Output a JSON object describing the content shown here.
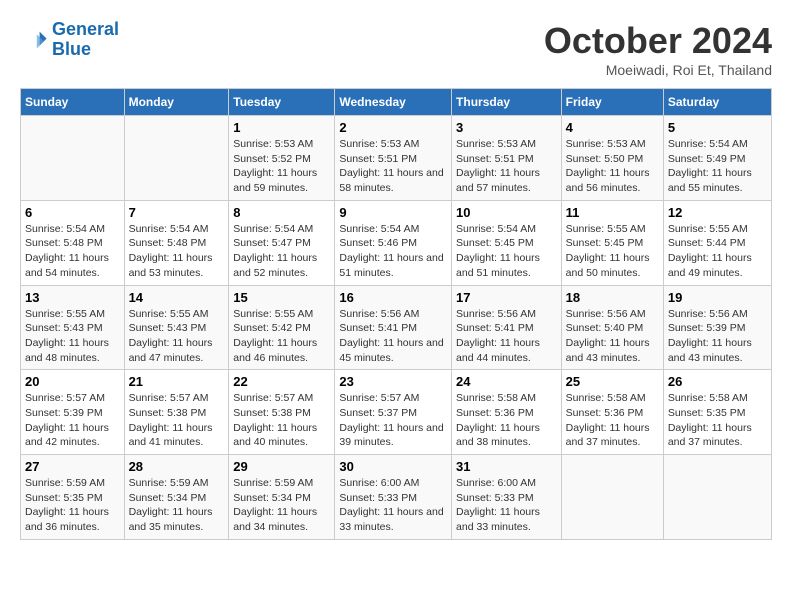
{
  "header": {
    "logo_line1": "General",
    "logo_line2": "Blue",
    "month_year": "October 2024",
    "location": "Moeiwadi, Roi Et, Thailand"
  },
  "weekdays": [
    "Sunday",
    "Monday",
    "Tuesday",
    "Wednesday",
    "Thursday",
    "Friday",
    "Saturday"
  ],
  "weeks": [
    [
      {
        "day": "",
        "content": ""
      },
      {
        "day": "",
        "content": ""
      },
      {
        "day": "1",
        "sunrise": "Sunrise: 5:53 AM",
        "sunset": "Sunset: 5:52 PM",
        "daylight": "Daylight: 11 hours and 59 minutes."
      },
      {
        "day": "2",
        "sunrise": "Sunrise: 5:53 AM",
        "sunset": "Sunset: 5:51 PM",
        "daylight": "Daylight: 11 hours and 58 minutes."
      },
      {
        "day": "3",
        "sunrise": "Sunrise: 5:53 AM",
        "sunset": "Sunset: 5:51 PM",
        "daylight": "Daylight: 11 hours and 57 minutes."
      },
      {
        "day": "4",
        "sunrise": "Sunrise: 5:53 AM",
        "sunset": "Sunset: 5:50 PM",
        "daylight": "Daylight: 11 hours and 56 minutes."
      },
      {
        "day": "5",
        "sunrise": "Sunrise: 5:54 AM",
        "sunset": "Sunset: 5:49 PM",
        "daylight": "Daylight: 11 hours and 55 minutes."
      }
    ],
    [
      {
        "day": "6",
        "sunrise": "Sunrise: 5:54 AM",
        "sunset": "Sunset: 5:48 PM",
        "daylight": "Daylight: 11 hours and 54 minutes."
      },
      {
        "day": "7",
        "sunrise": "Sunrise: 5:54 AM",
        "sunset": "Sunset: 5:48 PM",
        "daylight": "Daylight: 11 hours and 53 minutes."
      },
      {
        "day": "8",
        "sunrise": "Sunrise: 5:54 AM",
        "sunset": "Sunset: 5:47 PM",
        "daylight": "Daylight: 11 hours and 52 minutes."
      },
      {
        "day": "9",
        "sunrise": "Sunrise: 5:54 AM",
        "sunset": "Sunset: 5:46 PM",
        "daylight": "Daylight: 11 hours and 51 minutes."
      },
      {
        "day": "10",
        "sunrise": "Sunrise: 5:54 AM",
        "sunset": "Sunset: 5:45 PM",
        "daylight": "Daylight: 11 hours and 51 minutes."
      },
      {
        "day": "11",
        "sunrise": "Sunrise: 5:55 AM",
        "sunset": "Sunset: 5:45 PM",
        "daylight": "Daylight: 11 hours and 50 minutes."
      },
      {
        "day": "12",
        "sunrise": "Sunrise: 5:55 AM",
        "sunset": "Sunset: 5:44 PM",
        "daylight": "Daylight: 11 hours and 49 minutes."
      }
    ],
    [
      {
        "day": "13",
        "sunrise": "Sunrise: 5:55 AM",
        "sunset": "Sunset: 5:43 PM",
        "daylight": "Daylight: 11 hours and 48 minutes."
      },
      {
        "day": "14",
        "sunrise": "Sunrise: 5:55 AM",
        "sunset": "Sunset: 5:43 PM",
        "daylight": "Daylight: 11 hours and 47 minutes."
      },
      {
        "day": "15",
        "sunrise": "Sunrise: 5:55 AM",
        "sunset": "Sunset: 5:42 PM",
        "daylight": "Daylight: 11 hours and 46 minutes."
      },
      {
        "day": "16",
        "sunrise": "Sunrise: 5:56 AM",
        "sunset": "Sunset: 5:41 PM",
        "daylight": "Daylight: 11 hours and 45 minutes."
      },
      {
        "day": "17",
        "sunrise": "Sunrise: 5:56 AM",
        "sunset": "Sunset: 5:41 PM",
        "daylight": "Daylight: 11 hours and 44 minutes."
      },
      {
        "day": "18",
        "sunrise": "Sunrise: 5:56 AM",
        "sunset": "Sunset: 5:40 PM",
        "daylight": "Daylight: 11 hours and 43 minutes."
      },
      {
        "day": "19",
        "sunrise": "Sunrise: 5:56 AM",
        "sunset": "Sunset: 5:39 PM",
        "daylight": "Daylight: 11 hours and 43 minutes."
      }
    ],
    [
      {
        "day": "20",
        "sunrise": "Sunrise: 5:57 AM",
        "sunset": "Sunset: 5:39 PM",
        "daylight": "Daylight: 11 hours and 42 minutes."
      },
      {
        "day": "21",
        "sunrise": "Sunrise: 5:57 AM",
        "sunset": "Sunset: 5:38 PM",
        "daylight": "Daylight: 11 hours and 41 minutes."
      },
      {
        "day": "22",
        "sunrise": "Sunrise: 5:57 AM",
        "sunset": "Sunset: 5:38 PM",
        "daylight": "Daylight: 11 hours and 40 minutes."
      },
      {
        "day": "23",
        "sunrise": "Sunrise: 5:57 AM",
        "sunset": "Sunset: 5:37 PM",
        "daylight": "Daylight: 11 hours and 39 minutes."
      },
      {
        "day": "24",
        "sunrise": "Sunrise: 5:58 AM",
        "sunset": "Sunset: 5:36 PM",
        "daylight": "Daylight: 11 hours and 38 minutes."
      },
      {
        "day": "25",
        "sunrise": "Sunrise: 5:58 AM",
        "sunset": "Sunset: 5:36 PM",
        "daylight": "Daylight: 11 hours and 37 minutes."
      },
      {
        "day": "26",
        "sunrise": "Sunrise: 5:58 AM",
        "sunset": "Sunset: 5:35 PM",
        "daylight": "Daylight: 11 hours and 37 minutes."
      }
    ],
    [
      {
        "day": "27",
        "sunrise": "Sunrise: 5:59 AM",
        "sunset": "Sunset: 5:35 PM",
        "daylight": "Daylight: 11 hours and 36 minutes."
      },
      {
        "day": "28",
        "sunrise": "Sunrise: 5:59 AM",
        "sunset": "Sunset: 5:34 PM",
        "daylight": "Daylight: 11 hours and 35 minutes."
      },
      {
        "day": "29",
        "sunrise": "Sunrise: 5:59 AM",
        "sunset": "Sunset: 5:34 PM",
        "daylight": "Daylight: 11 hours and 34 minutes."
      },
      {
        "day": "30",
        "sunrise": "Sunrise: 6:00 AM",
        "sunset": "Sunset: 5:33 PM",
        "daylight": "Daylight: 11 hours and 33 minutes."
      },
      {
        "day": "31",
        "sunrise": "Sunrise: 6:00 AM",
        "sunset": "Sunset: 5:33 PM",
        "daylight": "Daylight: 11 hours and 33 minutes."
      },
      {
        "day": "",
        "content": ""
      },
      {
        "day": "",
        "content": ""
      }
    ]
  ]
}
